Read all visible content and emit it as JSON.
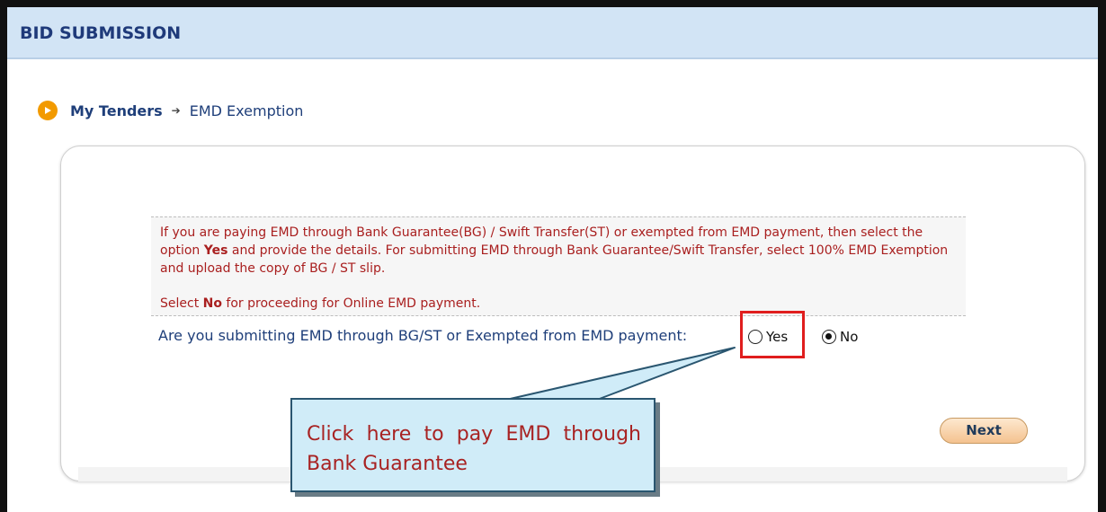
{
  "header": {
    "title": "BID SUBMISSION"
  },
  "breadcrumb": {
    "link": "My Tenders",
    "separator": "➔",
    "current": "EMD Exemption"
  },
  "info": {
    "para1_before": "If you are paying EMD through Bank Guarantee(BG) / Swift Transfer(ST) or exempted from EMD payment, then select the option ",
    "para1_bold": "Yes",
    "para1_after": " and provide the details. For submitting EMD through Bank Guarantee/Swift Transfer, select 100% EMD Exemption and upload the copy of BG / ST slip.",
    "para2_before": "Select ",
    "para2_bold": "No",
    "para2_after": " for proceeding for Online EMD payment."
  },
  "question": "Are you submitting EMD through BG/ST or Exempted from EMD payment:",
  "options": [
    {
      "label": "Yes",
      "selected": false
    },
    {
      "label": "No",
      "selected": true
    }
  ],
  "next_label": "Next",
  "callout": "Click here to pay EMD through Bank Guarantee",
  "colors": {
    "header_bg": "#d2e4f5",
    "accent_orange": "#f29a00",
    "info_text": "#a91f1f",
    "highlight": "#e01e1e",
    "callout_bg": "#d0ecf8"
  },
  "icons": {
    "breadcrumb_bullet": "play-circle-icon"
  }
}
